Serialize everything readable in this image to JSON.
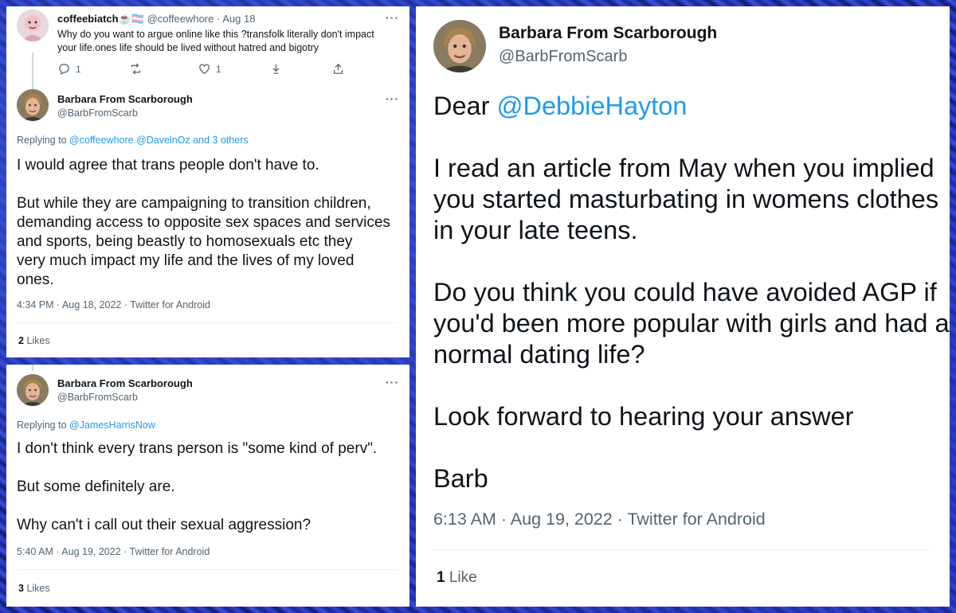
{
  "tweet1": {
    "display_name": "coffeebiatch",
    "name_emoji": "☕🏳️‍⚧️",
    "handle": "@coffeewhore",
    "date": "· Aug 18",
    "text_line1": "Why do you want to argue online like this ?transfolk literally don't impact",
    "text_line2": "your life.ones life should be lived without hatred and bigotry",
    "reply_count": "1",
    "like_count": "1"
  },
  "reply1": {
    "display_name": "Barbara From Scarborough",
    "handle": "@BarbFromScarb",
    "replying_to_label": "Replying to",
    "replying_to_links": "@coffeewhore @DavelnOz and 3 others",
    "para1": "I would agree that trans people don't have to.",
    "para2_line1": "But while they are campaigning to transition children,",
    "para2_line2": "demanding access to opposite sex spaces and services",
    "para2_line3": "and sports,  being beastly to homosexuals etc they",
    "para2_line4": "very much impact my life and the lives of my loved",
    "para2_line5": "ones.",
    "timestamp": "4:34 PM · Aug 18, 2022 · Twitter for Android",
    "likes_count": "2",
    "likes_label": "Likes"
  },
  "tweet2": {
    "display_name": "Barbara From Scarborough",
    "handle": "@BarbFromScarb",
    "replying_to_label": "Replying to",
    "replying_to_links": "@JamesHarrisNow",
    "para1": "I don't think every trans person is \"some kind of perv\".",
    "para2": "But some definitely are.",
    "para3": "Why can't i call out their sexual aggression?",
    "timestamp": "5:40 AM · Aug 19, 2022 · Twitter for Android",
    "likes_count": "3",
    "likes_label": "Likes"
  },
  "tweet3": {
    "display_name": "Barbara From Scarborough",
    "handle": "@BarbFromScarb",
    "greeting": "Dear",
    "mention": "@DebbieHayton",
    "para2_line1": "I read an article from May when you implied",
    "para2_line2": "you started masturbating in womens clothes",
    "para2_line3": "in your late teens.",
    "para3_line1": "Do you think you could have avoided AGP if",
    "para3_line2": "you'd been more popular with girls and had a",
    "para3_line3": "normal dating life?",
    "para4": "Look forward to hearing your answer",
    "para5": "Barb",
    "timestamp": "6:13 AM · Aug 19, 2022 · Twitter for Android",
    "likes_count": "1",
    "likes_label": "Like"
  },
  "colors": {
    "link": "#1d9bf0",
    "secondary_text": "#536471",
    "primary_text": "#0f1419",
    "background_blue": "#1e2ba0"
  },
  "icons": [
    "more-icon",
    "reply-icon",
    "retweet-icon",
    "like-icon",
    "share-down-icon",
    "share-up-icon"
  ]
}
